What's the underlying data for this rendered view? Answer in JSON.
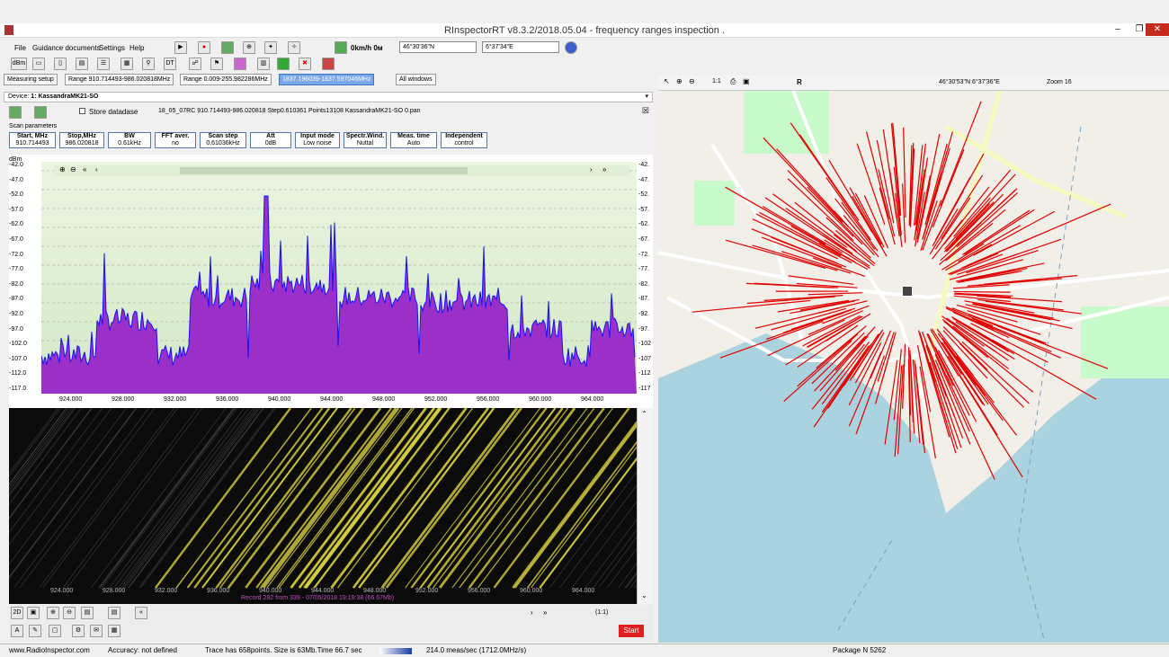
{
  "window": {
    "title": "RInspectorRT v8.3.2/2018.05.04 - frequency ranges inspection .",
    "min": "–",
    "max": "❐",
    "close": "✕"
  },
  "menu": [
    "File",
    "Guidance documents",
    "Settings",
    "Help"
  ],
  "toolbar": {
    "speed": "0km/h 0м",
    "lat": "46°30'36\"N",
    "lon": "6°37'34\"E",
    "dbm": "dBm"
  },
  "tabs": [
    {
      "label": "Measuring setup"
    },
    {
      "label": "Range 910.714493-986.020818MHz"
    },
    {
      "label": "Range 0.009-255.982286MHz"
    },
    {
      "label": "1837.196039-1837.597046MHz"
    },
    {
      "label": "All windows"
    }
  ],
  "device": {
    "label": "Device:",
    "value": "1: KassandraMK21-SO"
  },
  "file": {
    "store_label": "Store datadase",
    "filename": "18_05_07RC 910.714493-986.020818 Step0.610361 Points13108 KassandraMK21-SO 0.pan"
  },
  "scan": {
    "heading": "Scan parameters",
    "params": [
      {
        "name": "Start, MHz",
        "value": "910.714493"
      },
      {
        "name": "Stop,MHz",
        "value": "986.020818"
      },
      {
        "name": "BW",
        "value": "0.61kHz"
      },
      {
        "name": "FFT aver.",
        "value": "no"
      },
      {
        "name": "Scan step",
        "value": "0.61036kHz"
      },
      {
        "name": "Att",
        "value": "0dB"
      },
      {
        "name": "Input mode",
        "value": "Low noise"
      },
      {
        "name": "Spectr.Wind.",
        "value": "Nuttal"
      },
      {
        "name": "Meas. time",
        "value": "Auto"
      },
      {
        "name": "Independent",
        "value": "control"
      }
    ]
  },
  "spectrum": {
    "unit": "dBm",
    "yticks": [
      "-42.0",
      "-47.0",
      "-52.0",
      "-57.0",
      "-62.0",
      "-67.0",
      "-72.0",
      "-77.0",
      "-82.0",
      "-87.0",
      "-92.0",
      "-97.0",
      "-102.0",
      "-107.0",
      "-112.0",
      "-117.0"
    ],
    "yticks_right": [
      "-42.",
      "-47.",
      "-52.",
      "-57.",
      "-62.",
      "-67.",
      "-72.",
      "-77.",
      "-82.",
      "-87.",
      "-92.",
      "-97.",
      "-102",
      "-107",
      "-112",
      "-117"
    ],
    "xticks": [
      "924.000",
      "928.000",
      "932.000",
      "936.000",
      "940.000",
      "944.000",
      "948.000",
      "952.000",
      "956.000",
      "960.000",
      "964.000"
    ]
  },
  "waterfall": {
    "record": "Record 292 from 339 - 07/05/2018 19:19:38 (66.67Mb)"
  },
  "bottom": {
    "zoom_ratio": "(1:1)",
    "start_label": "Start",
    "mode": "2D"
  },
  "map": {
    "coords": "46°30'53\"N 6°37'36\"E",
    "zoom": "Zoom 16"
  },
  "status": {
    "site": "www.RadioInspector.com",
    "accuracy": "Accuracy: not defined",
    "trace": "Trace has 658points. Size is 63Mb.Time 66.7 sec",
    "rate": "214.0 meas/sec (1712.0MHz/s)",
    "package": "Package N 5262"
  },
  "colors": {
    "spectrum_blue": "#1414ff",
    "spectrum_fill": "#9b30c8",
    "trace_red": "#e00000",
    "waterfall_yellow": "#d8d040"
  }
}
